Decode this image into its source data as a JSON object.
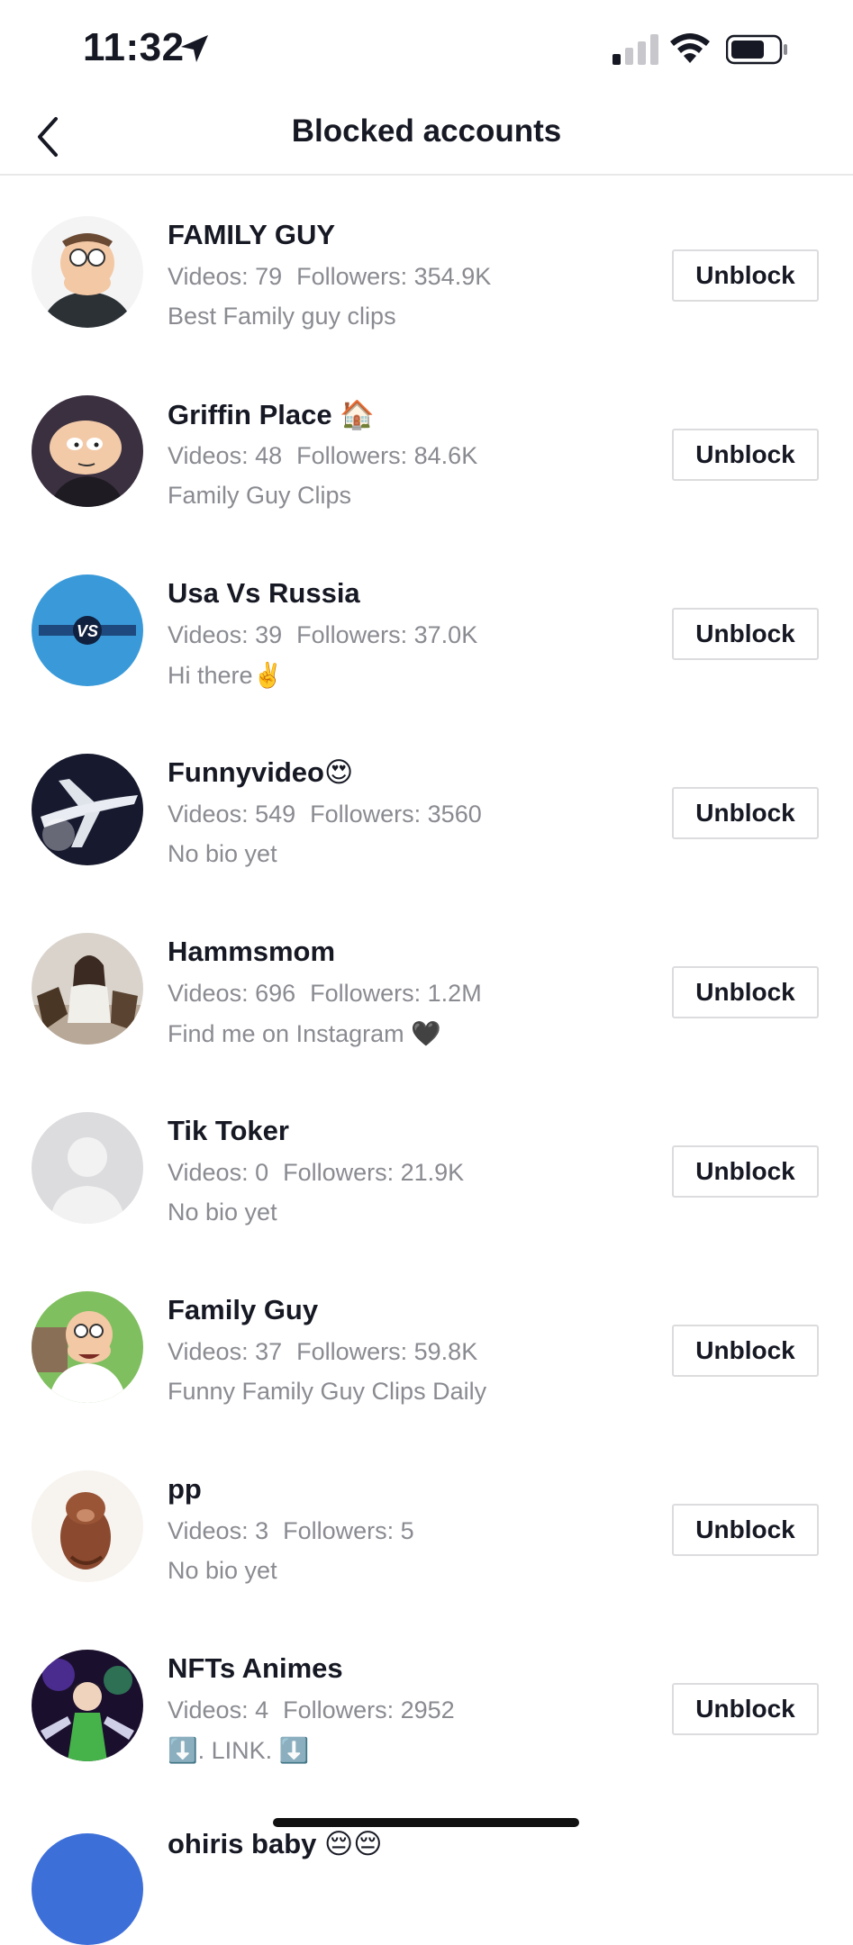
{
  "status_bar": {
    "time": "11:32"
  },
  "header": {
    "title": "Blocked accounts"
  },
  "accounts": [
    {
      "name": "FAMILY GUY",
      "videos": "Videos: 79",
      "followers": "Followers: 354.9K",
      "bio": "Best Family guy clips",
      "button": "Unblock"
    },
    {
      "name": "Griffin Place 🏠",
      "videos": "Videos: 48",
      "followers": "Followers: 84.6K",
      "bio": "Family Guy Clips",
      "button": "Unblock"
    },
    {
      "name": "Usa Vs Russia",
      "videos": "Videos: 39",
      "followers": "Followers: 37.0K",
      "bio": "Hi there✌️",
      "button": "Unblock"
    },
    {
      "name": "Funnyvideo😍",
      "videos": "Videos: 549",
      "followers": "Followers: 3560",
      "bio": "No bio yet",
      "button": "Unblock"
    },
    {
      "name": "Hammsmom",
      "videos": "Videos: 696",
      "followers": "Followers: 1.2M",
      "bio": "Find me on Instagram 🖤",
      "button": "Unblock"
    },
    {
      "name": "Tik Toker",
      "videos": "Videos: 0",
      "followers": "Followers: 21.9K",
      "bio": "No bio yet",
      "button": "Unblock"
    },
    {
      "name": "Family Guy",
      "videos": "Videos: 37",
      "followers": "Followers: 59.8K",
      "bio": "Funny Family Guy Clips Daily",
      "button": "Unblock"
    },
    {
      "name": "pp",
      "videos": "Videos: 3",
      "followers": "Followers: 5",
      "bio": "No bio yet",
      "button": "Unblock"
    },
    {
      "name": "NFTs Animes",
      "videos": "Videos: 4",
      "followers": "Followers: 2952",
      "bio": "⬇️.        LINK.        ⬇️",
      "button": "Unblock"
    }
  ],
  "avatars": {
    "family_guy": "peter-avatar-icon",
    "griffin_place": "stewie-avatar-icon",
    "usa_vs_russia": "vs-logo-avatar-icon",
    "funnyvideo": "airplane-avatar-icon",
    "hammsmom": "woman-dogs-avatar-icon",
    "tik_toker": "default-user-avatar-icon",
    "family_guy_2": "peter-avatar-icon",
    "pp": "hog-avatar-icon",
    "nfts_animes": "anime-avatar-icon"
  },
  "partial_row": {
    "name": "ohiris baby 😔😔"
  }
}
